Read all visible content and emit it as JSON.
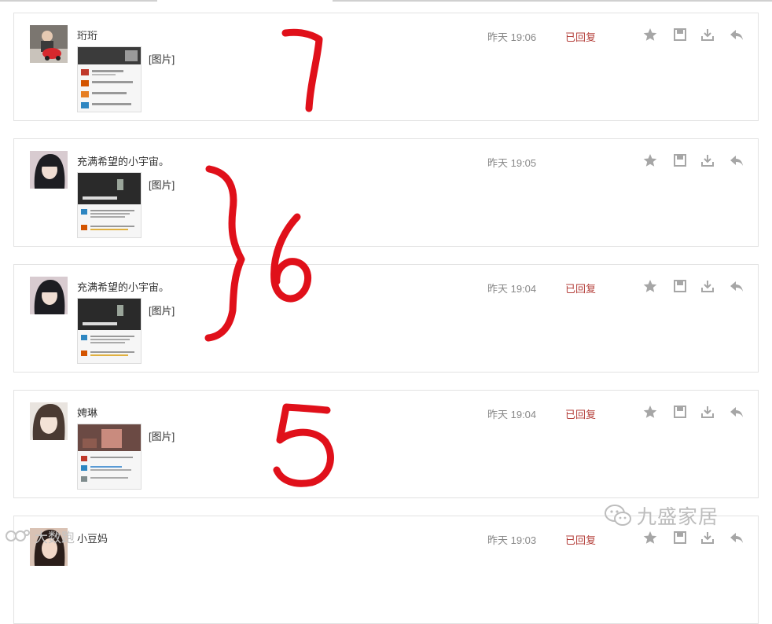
{
  "messages": [
    {
      "name": "珩珩",
      "image_label": "[图片]",
      "time": "昨天 19:06",
      "status": "已回复",
      "avatar": "avatar-kid"
    },
    {
      "name": "充满希望的小宇宙。",
      "image_label": "[图片]",
      "time": "昨天 19:05",
      "status": "",
      "avatar": "avatar-girl-dark"
    },
    {
      "name": "充满希望的小宇宙。",
      "image_label": "[图片]",
      "time": "昨天 19:04",
      "status": "已回复",
      "avatar": "avatar-girl-dark"
    },
    {
      "name": "娉琳",
      "image_label": "[图片]",
      "time": "昨天 19:04",
      "status": "已回复",
      "avatar": "avatar-girl-light"
    },
    {
      "name": "小豆妈",
      "image_label": "",
      "time": "昨天 19:03",
      "status": "已回复",
      "avatar": "avatar-woman"
    }
  ],
  "actions": [
    "star-icon",
    "save-icon",
    "download-icon",
    "reply-icon"
  ],
  "annotations": [
    "7",
    "6",
    "5"
  ],
  "watermarks": {
    "right": "九盛家居",
    "left": "大数跑"
  },
  "colors": {
    "replied": "#b5413c",
    "annotation": "#e0101a",
    "icon": "#a6a6a6",
    "border": "#e2e2e2"
  }
}
